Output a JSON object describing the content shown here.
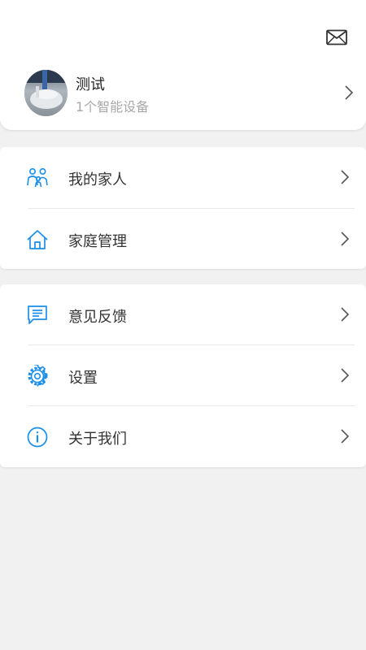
{
  "header": {
    "mail_icon": "mail-icon",
    "profile": {
      "name": "测试",
      "device_count": "1个智能设备"
    }
  },
  "menu_groups": [
    {
      "items": [
        {
          "label": "我的家人",
          "icon": "family-icon"
        },
        {
          "label": "家庭管理",
          "icon": "home-icon"
        }
      ]
    },
    {
      "items": [
        {
          "label": "意见反馈",
          "icon": "feedback-icon"
        },
        {
          "label": "设置",
          "icon": "gear-icon"
        },
        {
          "label": "关于我们",
          "icon": "info-icon"
        }
      ]
    }
  ],
  "colors": {
    "accent": "#1a8ee8",
    "background": "#f1f1f1",
    "card": "#ffffff",
    "secondary_text": "#a8a8a8"
  }
}
